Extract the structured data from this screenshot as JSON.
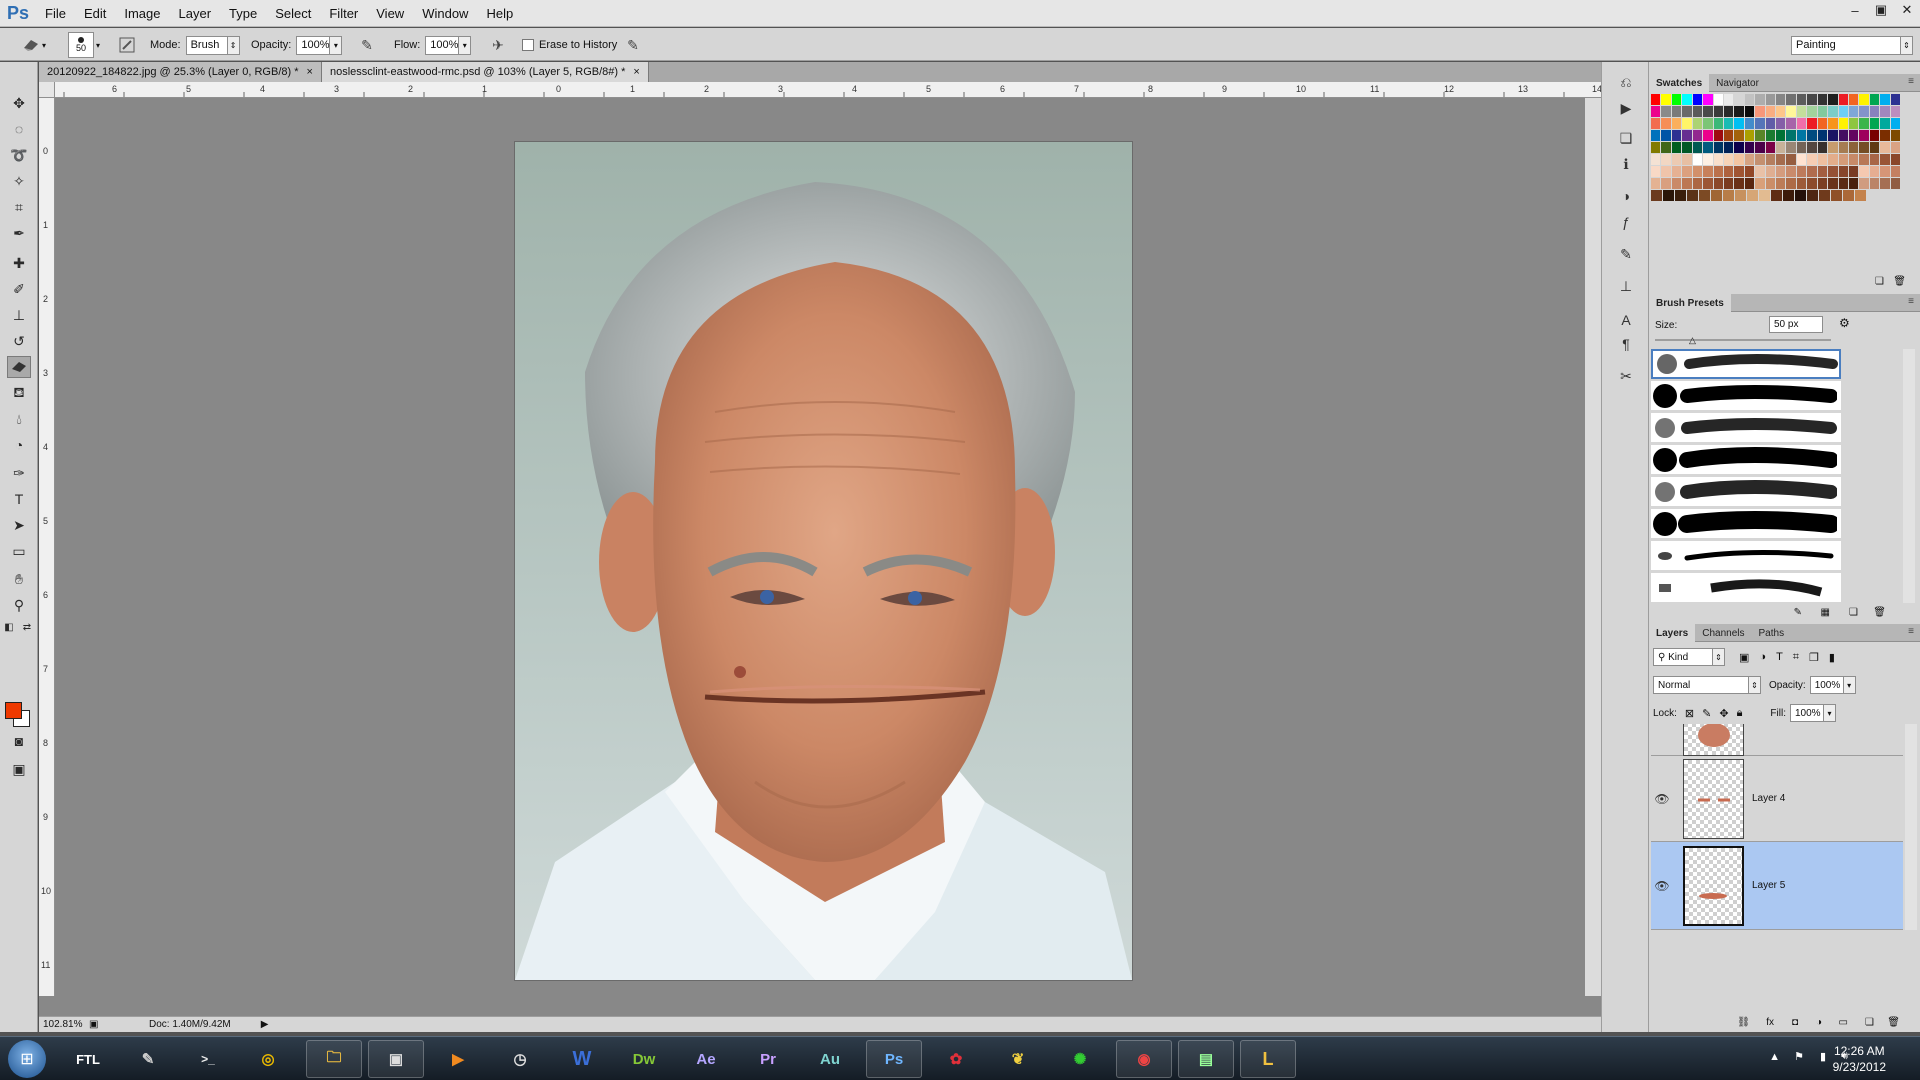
{
  "app": {
    "logo": "Ps"
  },
  "menu": [
    "File",
    "Edit",
    "Image",
    "Layer",
    "Type",
    "Select",
    "Filter",
    "View",
    "Window",
    "Help"
  ],
  "window_controls": [
    "–",
    "▣",
    "✕"
  ],
  "options": {
    "brush_size": "50",
    "mode_label": "Mode:",
    "mode_value": "Brush",
    "opacity_label": "Opacity:",
    "opacity_value": "100%",
    "flow_label": "Flow:",
    "flow_value": "100%",
    "erase_history": "Erase to History",
    "workspace": "Painting"
  },
  "tabs": [
    {
      "title": "20120922_184822.jpg @ 25.3% (Layer 0, RGB/8) *",
      "active": false
    },
    {
      "title": "noslessclint-eastwood-rmc.psd @ 103% (Layer 5, RGB/8#) *",
      "active": true
    }
  ],
  "ruler_h": [
    "6",
    "5",
    "4",
    "3",
    "2",
    "1",
    "0",
    "1",
    "2",
    "3",
    "4",
    "5",
    "6",
    "7",
    "8",
    "9",
    "10",
    "11",
    "12",
    "13",
    "14"
  ],
  "ruler_v": [
    "0",
    "1",
    "2",
    "3",
    "4",
    "5",
    "6",
    "7",
    "8",
    "9",
    "10",
    "11"
  ],
  "status": {
    "zoom": "102.81%",
    "doc": "Doc: 1.40M/9.42M"
  },
  "swatches_panel": {
    "tabs": [
      "Swatches",
      "Navigator"
    ]
  },
  "brush_presets": {
    "tab": "Brush Presets",
    "size_label": "Size:",
    "size_value": "50 px"
  },
  "layers_panel": {
    "tabs": [
      "Layers",
      "Channels",
      "Paths"
    ],
    "filter": "Kind",
    "blend_mode": "Normal",
    "opacity_label": "Opacity:",
    "opacity_value": "100%",
    "lock_label": "Lock:",
    "fill_label": "Fill:",
    "fill_value": "100%",
    "layers": [
      {
        "name": "Layer 4",
        "visible": true,
        "selected": false
      },
      {
        "name": "Layer 5",
        "visible": true,
        "selected": true
      }
    ]
  },
  "taskbar": {
    "clock_time": "12:26 AM",
    "clock_date": "9/23/2012",
    "apps": [
      "FTL",
      "W",
      "Dw",
      "Ae",
      "Pr",
      "Au",
      "Ps",
      "L"
    ]
  },
  "colors": {
    "foreground": "#ee3900",
    "background": "#ffffff",
    "selection": "#abc8f2"
  }
}
